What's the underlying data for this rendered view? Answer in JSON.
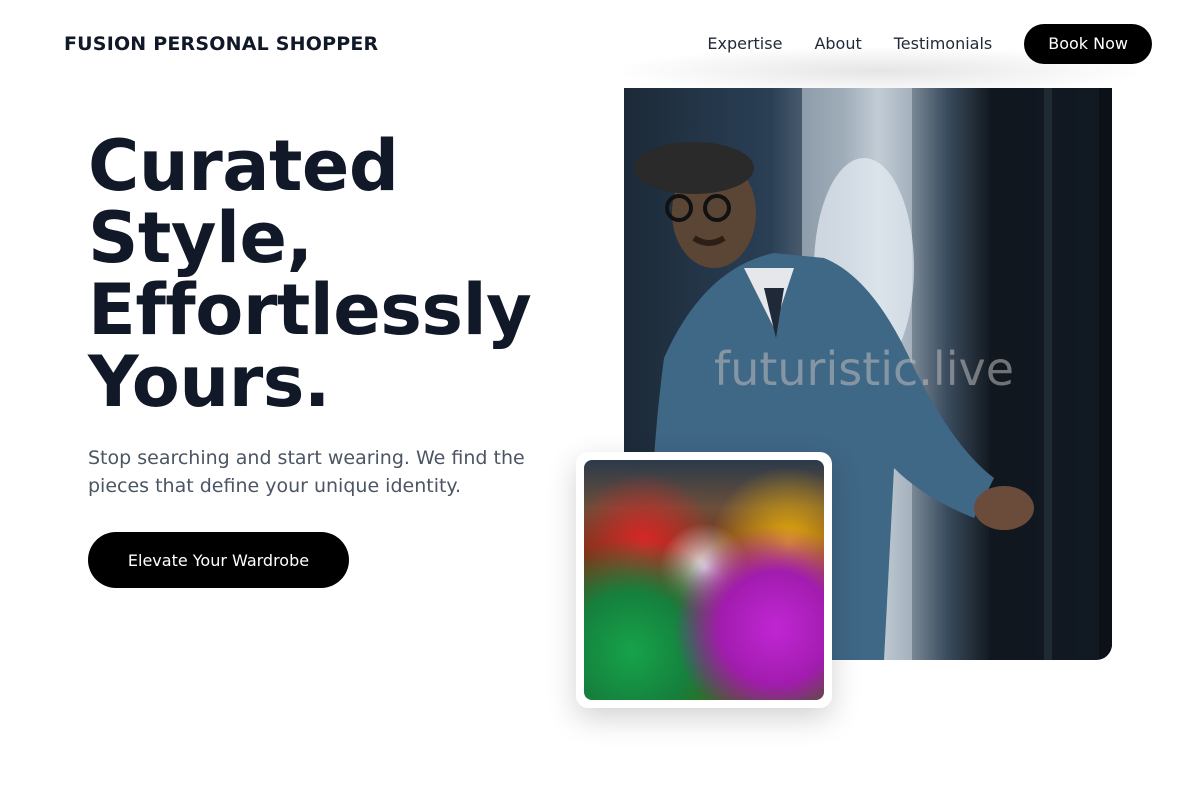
{
  "header": {
    "brand": "FUSION PERSONAL SHOPPER",
    "nav": [
      "Expertise",
      "About",
      "Testimonials"
    ],
    "book_label": "Book Now"
  },
  "hero": {
    "title_lines": [
      "Curated",
      "Style,",
      "Effortlessly",
      "Yours."
    ],
    "subtitle": "Stop searching and start wearing. We find the pieces that define your unique identity.",
    "cta_label": "Elevate Your Wardrobe"
  },
  "images": {
    "main_watermark": "futuristic.live",
    "main_icon": "shopper-in-boutique-photo",
    "inset_icon": "colorful-candy-pile-photo"
  },
  "colors": {
    "text_dark": "#111827",
    "text_muted": "#4b5563",
    "button_bg": "#000000",
    "button_text": "#ffffff"
  }
}
